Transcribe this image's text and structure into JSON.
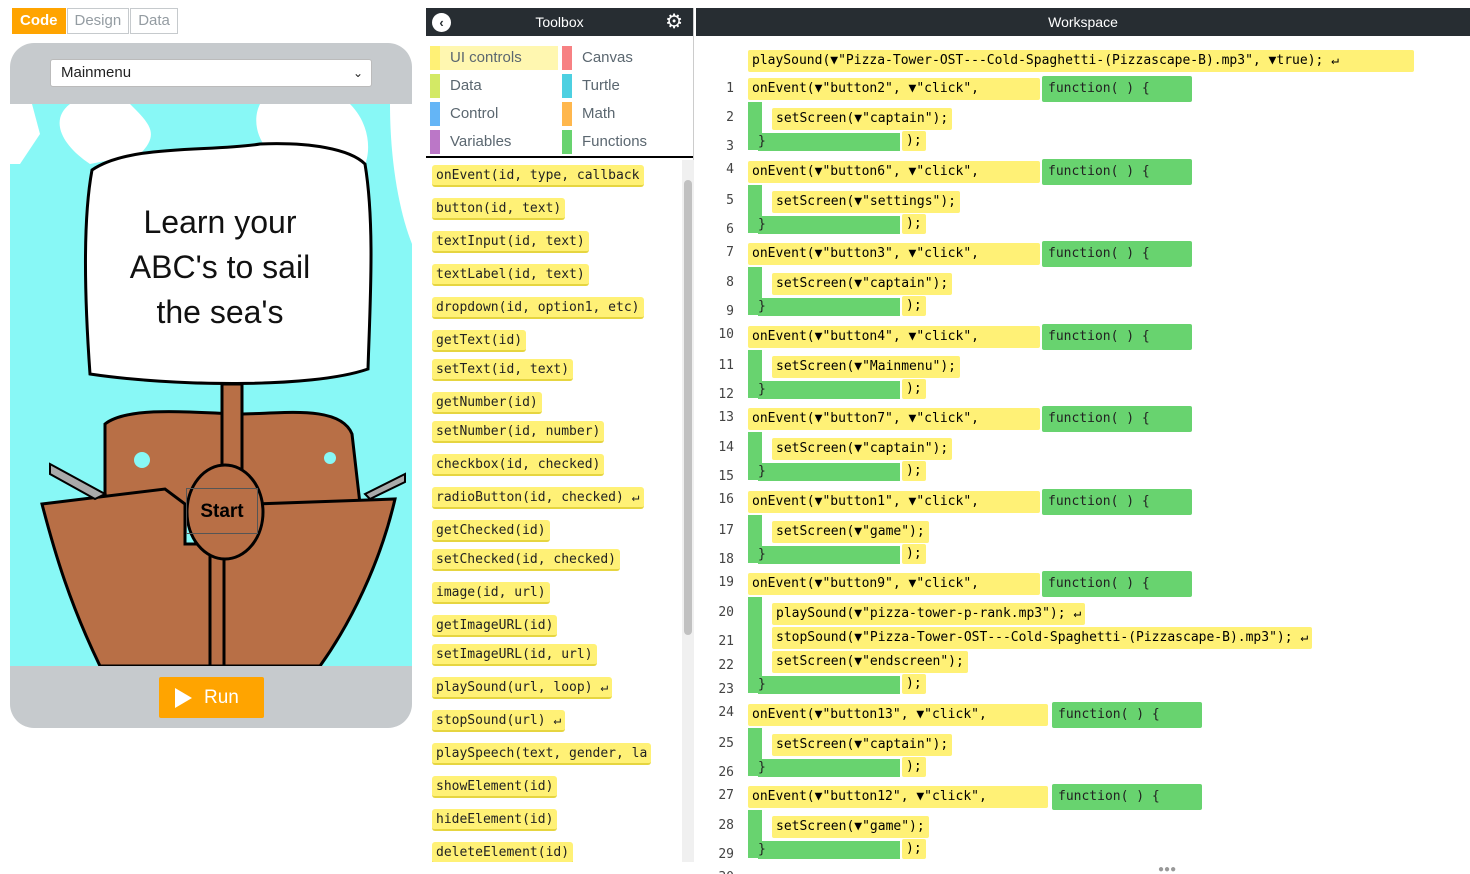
{
  "tabs": [
    "Code",
    "Design",
    "Data"
  ],
  "phone": {
    "screen_select": "Mainmenu",
    "sign_lines": [
      "Learn your",
      "ABC's to sail",
      "the sea's"
    ],
    "start_label": "Start",
    "run_label": "Run"
  },
  "toolbox": {
    "title": "Toolbox",
    "categories": [
      {
        "label": "UI controls",
        "color": "#fff176"
      },
      {
        "label": "Canvas",
        "color": "#f78183"
      },
      {
        "label": "Data",
        "color": "#d3e965"
      },
      {
        "label": "Turtle",
        "color": "#4dd0e1"
      },
      {
        "label": "Control",
        "color": "#64b5f6"
      },
      {
        "label": "Math",
        "color": "#ffb74d"
      },
      {
        "label": "Variables",
        "color": "#bb77c7"
      },
      {
        "label": "Functions",
        "color": "#68d36f"
      }
    ],
    "blocks": [
      "onEvent(id, type, callback",
      "button(id, text)",
      "textInput(id, text)",
      "textLabel(id, text)",
      "dropdown(id, option1, etc)",
      "getText(id)",
      "setText(id, text)",
      "getNumber(id)",
      "setNumber(id, number)",
      "checkbox(id, checked)",
      "radioButton(id, checked) ↵",
      "getChecked(id)",
      "setChecked(id, checked)",
      "image(id, url)",
      "getImageURL(id)",
      "setImageURL(id, url)",
      "playSound(url, loop) ↵",
      "stopSound(url) ↵",
      "playSpeech(text, gender, la",
      "showElement(id)",
      "hideElement(id)",
      "deleteElement(id)"
    ]
  },
  "workspace": {
    "title": "Workspace",
    "line1": "playSound(▼\"Pizza-Tower-OST---Cold-Spaghetti-(Pizzascape-B).mp3\", ▼true); ↵",
    "events": [
      {
        "button": "button2",
        "actions": [
          "setScreen(▼\"captain\");"
        ]
      },
      {
        "button": "button6",
        "actions": [
          "setScreen(▼\"settings\");"
        ]
      },
      {
        "button": "button3",
        "actions": [
          "setScreen(▼\"captain\");"
        ]
      },
      {
        "button": "button4",
        "actions": [
          "setScreen(▼\"Mainmenu\");"
        ]
      },
      {
        "button": "button7",
        "actions": [
          "setScreen(▼\"captain\");"
        ]
      },
      {
        "button": "button1",
        "actions": [
          "setScreen(▼\"game\");"
        ]
      },
      {
        "button": "button9",
        "actions": [
          "playSound(▼\"pizza-tower-p-rank.mp3\"); ↵",
          "stopSound(▼\"Pizza-Tower-OST---Cold-Spaghetti-(Pizzascape-B).mp3\"); ↵",
          "setScreen(▼\"endscreen\");"
        ]
      },
      {
        "button": "button13",
        "actions": [
          "setScreen(▼\"captain\");"
        ]
      },
      {
        "button": "button12",
        "actions": [
          "setScreen(▼\"game\");"
        ]
      }
    ],
    "click": "▼\"click\",",
    "function_label": "function( ) {",
    "close": ");"
  }
}
